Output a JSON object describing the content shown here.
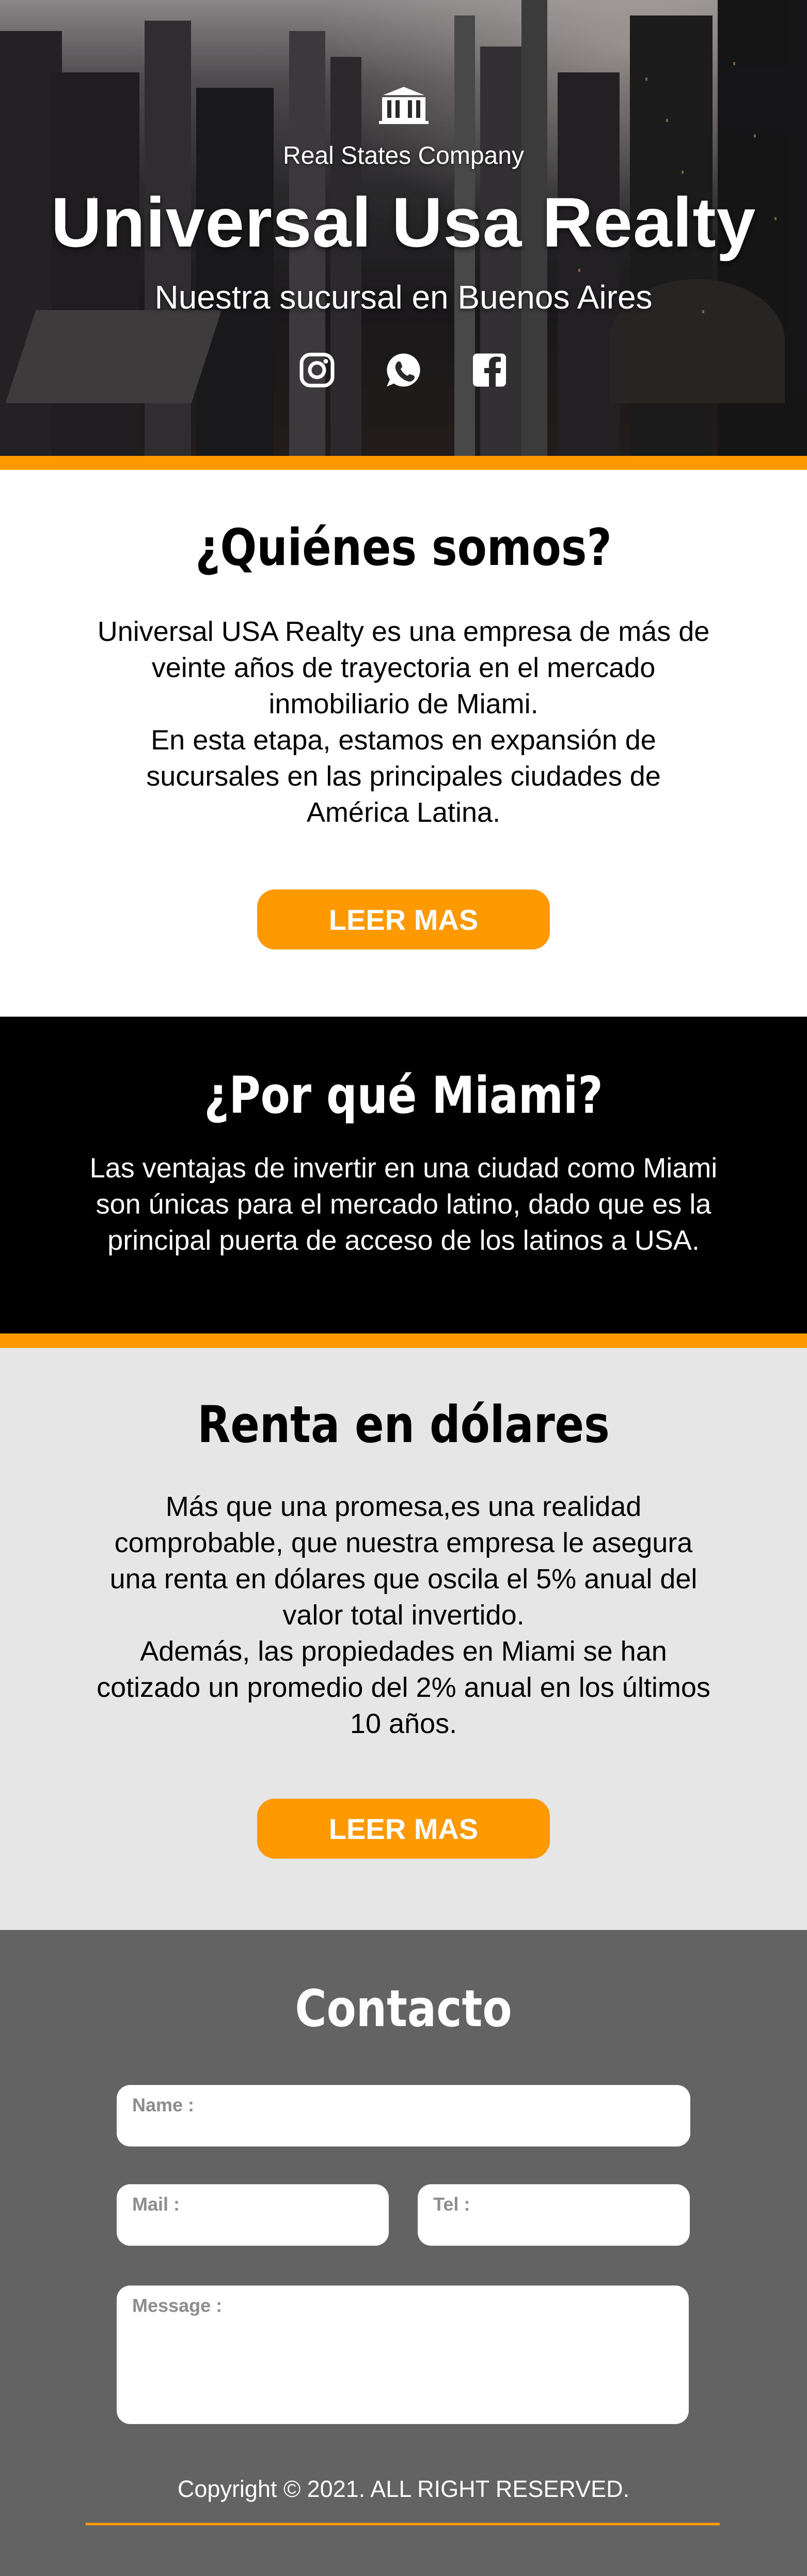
{
  "hero": {
    "company": "Real States Company",
    "title": "Universal Usa Realty",
    "subtitle": "Nuestra sucursal en Buenos Aires",
    "logo_icon": "building-icon",
    "social_icons": [
      "instagram-icon",
      "whatsapp-icon",
      "facebook-icon"
    ]
  },
  "quienes": {
    "title": "¿Quiénes somos?",
    "body": "Universal USA Realty es una empresa de más de\nveinte años de trayectoria en el mercado\ninmobiliario de Miami.\nEn esta etapa, estamos en expansión de\nsucursales en las principales ciudades de\nAmérica Latina.",
    "button": "LEER MAS"
  },
  "miami": {
    "title": "¿Por qué Miami?",
    "body": "Las ventajas de invertir en una ciudad como Miami\nson únicas para el mercado latino, dado que es la\nprincipal puerta de acceso de los latinos a USA."
  },
  "renta": {
    "title": "Renta en dólares",
    "body": "Más que una promesa,es una realidad\ncomprobable, que nuestra empresa le asegura\nuna renta en dólares que oscila el 5% anual del\nvalor total invertido.\nAdemás, las propiedades en Miami se han\ncotizado un promedio del 2% anual en los últimos\n10 años.",
    "button": "LEER MAS"
  },
  "contacto": {
    "title": "Contacto",
    "name_label": "Name :",
    "mail_label": "Mail :",
    "tel_label": "Tel :",
    "message_label": "Message :"
  },
  "footer": {
    "copyright": "Copyright © 2021. ALL RIGHT RESERVED."
  },
  "colors": {
    "accent": "#ff9900",
    "dark": "#000000",
    "light_gray": "#e6e6e6",
    "contact_bg": "#636363"
  }
}
